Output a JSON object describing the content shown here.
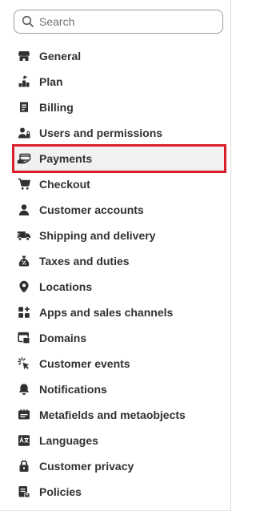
{
  "search": {
    "placeholder": "Search",
    "icon": "search-icon"
  },
  "nav": {
    "items": [
      {
        "label": "General",
        "icon": "store-icon"
      },
      {
        "label": "Plan",
        "icon": "plan-icon"
      },
      {
        "label": "Billing",
        "icon": "receipt-icon"
      },
      {
        "label": "Users and permissions",
        "icon": "users-icon"
      },
      {
        "label": "Payments",
        "icon": "payment-hand-icon",
        "selected": true
      },
      {
        "label": "Checkout",
        "icon": "cart-icon"
      },
      {
        "label": "Customer accounts",
        "icon": "person-icon"
      },
      {
        "label": "Shipping and delivery",
        "icon": "truck-icon"
      },
      {
        "label": "Taxes and duties",
        "icon": "tax-bag-icon"
      },
      {
        "label": "Locations",
        "icon": "location-pin-icon"
      },
      {
        "label": "Apps and sales channels",
        "icon": "apps-icon"
      },
      {
        "label": "Domains",
        "icon": "domains-icon"
      },
      {
        "label": "Customer events",
        "icon": "cursor-click-icon"
      },
      {
        "label": "Notifications",
        "icon": "bell-icon"
      },
      {
        "label": "Metafields and metaobjects",
        "icon": "metafields-icon"
      },
      {
        "label": "Languages",
        "icon": "language-icon"
      },
      {
        "label": "Customer privacy",
        "icon": "lock-icon"
      },
      {
        "label": "Policies",
        "icon": "policy-icon"
      }
    ]
  },
  "colors": {
    "text": "#303030",
    "selection_outline": "#d9202a",
    "selected_background": "#f1f1f1"
  }
}
